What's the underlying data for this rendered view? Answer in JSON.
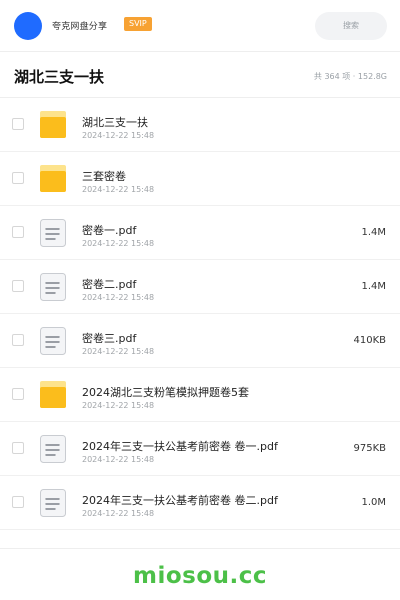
{
  "header": {
    "app_name": "夸克网盘分享",
    "vip_badge": "SVIP",
    "search_placeholder": "搜索"
  },
  "folder": {
    "title": "湖北三支一扶",
    "summary": "共 364 项 · 152.8G"
  },
  "colors": {
    "avatar": "#1f6bff",
    "vip_badge": "#f7a233",
    "folder_icon": "#fbbd1c",
    "watermark": "#4cc048"
  },
  "files": [
    {
      "name": "湖北三支一扶",
      "date": "2024-12-22 15:48",
      "size": "",
      "type": "folder"
    },
    {
      "name": "三套密卷",
      "date": "2024-12-22 15:48",
      "size": "",
      "type": "folder"
    },
    {
      "name": "密卷一.pdf",
      "date": "2024-12-22 15:48",
      "size": "1.4M",
      "type": "file"
    },
    {
      "name": "密卷二.pdf",
      "date": "2024-12-22 15:48",
      "size": "1.4M",
      "type": "file"
    },
    {
      "name": "密卷三.pdf",
      "date": "2024-12-22 15:48",
      "size": "410KB",
      "type": "file"
    },
    {
      "name": "2024湖北三支粉笔模拟押题卷5套",
      "date": "2024-12-22 15:48",
      "size": "",
      "type": "folder"
    },
    {
      "name": "2024年三支一扶公基考前密卷 卷一.pdf",
      "date": "2024-12-22 15:48",
      "size": "975KB",
      "type": "file"
    },
    {
      "name": "2024年三支一扶公基考前密卷 卷二.pdf",
      "date": "2024-12-22 15:48",
      "size": "1.0M",
      "type": "file"
    }
  ],
  "footer": {
    "watermark": "miosou.cc"
  }
}
